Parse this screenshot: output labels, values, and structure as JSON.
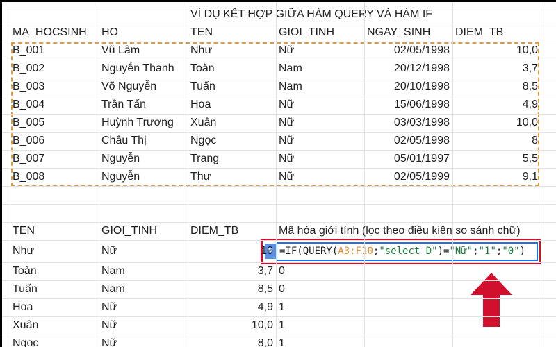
{
  "title": "VÍ DỤ KẾT HỢP GIỮA HÀM QUERY VÀ HÀM IF",
  "headers": [
    "MA_HOCSINH",
    "HO",
    "TEN",
    "GIOI_TINH",
    "NGAY_SINH",
    "DIEM_TB"
  ],
  "rows": [
    [
      "B_001",
      "Vũ Lâm",
      "Như",
      "Nữ",
      "02/05/1998",
      "10,0"
    ],
    [
      "B_002",
      "Nguyễn Thanh",
      "Toàn",
      "Nam",
      "20/12/1998",
      "3,7"
    ],
    [
      "B_003",
      "Võ Nguyễn",
      "Tuấn",
      "Nam",
      "20/10/1998",
      "8,5"
    ],
    [
      "B_004",
      "Trần Tấn",
      "Hoa",
      "Nữ",
      "15/06/1998",
      "4,9"
    ],
    [
      "B_005",
      "Huỳnh Trương",
      "Xuân",
      "Nữ",
      "03/03/1998",
      "10,0"
    ],
    [
      "B_006",
      "Châu Thị",
      "Ngọc",
      "Nữ",
      "02/05/1998",
      "8"
    ],
    [
      "B_007",
      "Nguyễn",
      "Trang",
      "Nữ",
      "05/01/1997",
      "5,5"
    ],
    [
      "B_008",
      "Nguyễn",
      "Thư",
      "Nữ",
      "02/05/1999",
      "9,1"
    ]
  ],
  "result_headers": [
    "TEN",
    "GIOI_TINH",
    "DIEM_TB",
    "Mã hóa giới tính (lọc theo điều kiện so sánh chữ)"
  ],
  "result_rows": [
    [
      "Như",
      "Nữ",
      "10",
      ""
    ],
    [
      "Toàn",
      "Nam",
      "3,7",
      "0"
    ],
    [
      "Tuấn",
      "Nam",
      "8,5",
      "0"
    ],
    [
      "Hoa",
      "Nữ",
      "4,9",
      "1"
    ],
    [
      "Xuân",
      "Nữ",
      "10,0",
      "1"
    ],
    [
      "Ngọc",
      "Nữ",
      "8,0",
      "1"
    ]
  ],
  "formula": {
    "prefix": "=IF(QUERY(",
    "range": "A3:F10",
    "sep1": ";",
    "str1": "\"select D\"",
    "mid": ")=",
    "str2": "\"Nữ\"",
    "sep2": ";",
    "str3": "\"1\"",
    "sep3": ";",
    "str4": "\"0\"",
    "suffix": ")",
    "help": "?"
  },
  "colors": {
    "selection": "#e69a2e",
    "highlight": "#d0102c",
    "editor": "#1a73e8"
  }
}
